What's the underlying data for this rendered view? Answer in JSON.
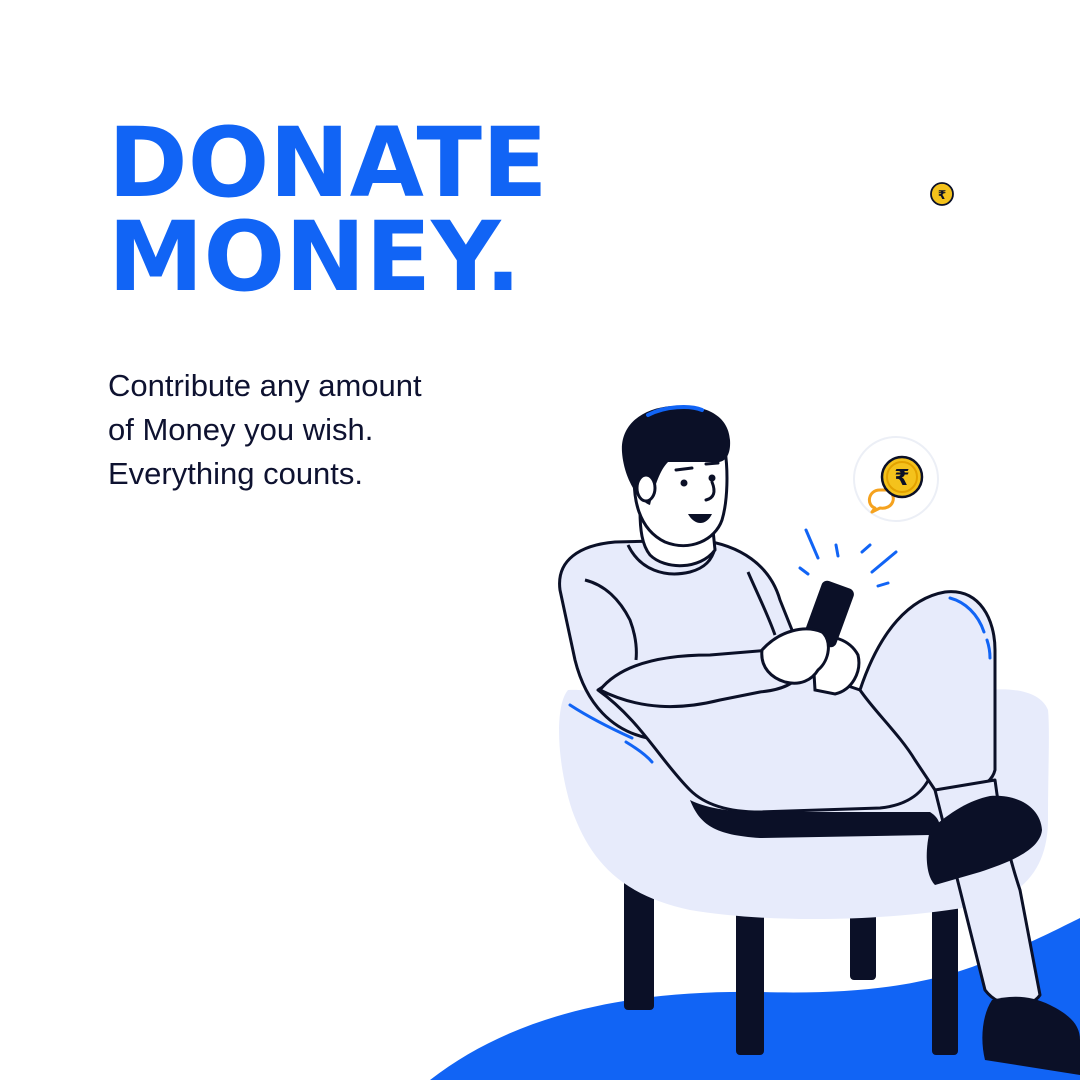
{
  "headline": {
    "line1": "DONATE",
    "line2": "MONEY."
  },
  "subtext": {
    "line1": "Contribute any amount",
    "line2": "of Money you wish.",
    "line3": "Everything counts."
  },
  "coin_symbol": "₹",
  "icons": [
    "rupee-coin-icon",
    "rupee-chat-bubble-icon"
  ],
  "colors": {
    "brand_blue": "#1164f5",
    "text_dark": "#0e1230",
    "outline": "#0b1027",
    "clothing": "#e7ebfb",
    "coin_gold": "#f4c21c",
    "coin_ring": "#e3a200",
    "bubble_orange": "#f5a21e",
    "background": "#ffffff"
  }
}
